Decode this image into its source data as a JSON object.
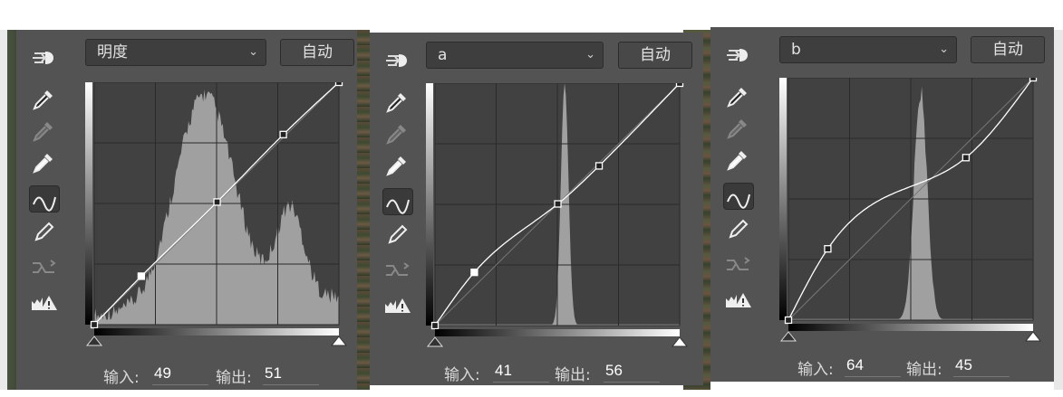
{
  "panels": [
    {
      "channel": "明度",
      "auto_label": "自动",
      "input_label": "输入:",
      "input_value": "49",
      "output_label": "输出:",
      "output_value": "51",
      "curve_points": [
        [
          0,
          0
        ],
        [
          49,
          51
        ],
        [
          128,
          129
        ],
        [
          197,
          200
        ],
        [
          255,
          255
        ]
      ]
    },
    {
      "channel": "a",
      "auto_label": "自动",
      "input_label": "输入:",
      "input_value": "41",
      "output_label": "输出:",
      "output_value": "56",
      "curve_points": [
        [
          0,
          0
        ],
        [
          41,
          56
        ],
        [
          128,
          128
        ],
        [
          171,
          168
        ],
        [
          255,
          255
        ]
      ]
    },
    {
      "channel": "b",
      "auto_label": "自动",
      "input_label": "输入:",
      "input_value": "64",
      "output_label": "输出:",
      "output_value": "45",
      "curve_points": [
        [
          0,
          0
        ],
        [
          41,
          75
        ],
        [
          185,
          171
        ],
        [
          255,
          255
        ]
      ]
    }
  ],
  "tools": [
    "target-adjust-icon",
    "black-point-eyedropper-icon",
    "gray-point-eyedropper-icon",
    "white-point-eyedropper-icon",
    "curve-points-icon",
    "pencil-icon",
    "smooth-curve-icon",
    "clipping-warning-icon"
  ]
}
